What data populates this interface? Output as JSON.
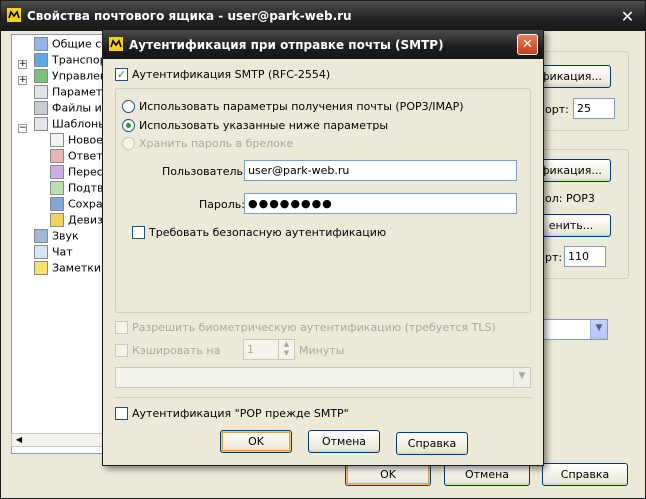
{
  "outer": {
    "title": "Свойства почтового ящика - user@park-web.ru",
    "tree": [
      {
        "label": "Общие сведения",
        "icon": "mailbox-icon",
        "expander": false
      },
      {
        "label": "Транспорт",
        "icon": "transport-icon",
        "expander": true
      },
      {
        "label": "Управление",
        "icon": "management-icon",
        "expander": true
      },
      {
        "label": "Параметры",
        "icon": "parameters-icon",
        "expander": false
      },
      {
        "label": "Файлы и каталоги",
        "icon": "files-icon",
        "expander": false
      },
      {
        "label": "Шаблоны",
        "icon": "templates-icon",
        "expander": true
      },
      {
        "label": "Новое",
        "icon": "new-template-icon",
        "expander": false
      },
      {
        "label": "Ответ",
        "icon": "reply-template-icon",
        "expander": false
      },
      {
        "label": "Пересылка",
        "icon": "forward-template-icon",
        "expander": false
      },
      {
        "label": "Подтверждение",
        "icon": "confirm-template-icon",
        "expander": false
      },
      {
        "label": "Сохранение",
        "icon": "save-template-icon",
        "expander": false
      },
      {
        "label": "Девиз",
        "icon": "motto-template-icon",
        "expander": false
      },
      {
        "label": "Звук",
        "icon": "sound-icon",
        "expander": false
      },
      {
        "label": "Чат",
        "icon": "chat-icon",
        "expander": false
      },
      {
        "label": "Заметки",
        "icon": "notes-icon",
        "expander": false
      }
    ],
    "right": {
      "auth_btn_1": "фикация...",
      "port_label_1": "орт:",
      "port_value_1": "25",
      "auth_btn_2": "фикация...",
      "proto_label": "ол:",
      "proto_value": "POP3",
      "change_btn": "енить...",
      "port_label_2": "рт:",
      "port_value_2": "110"
    },
    "buttons": {
      "ok": "OK",
      "cancel": "Отмена",
      "help": "Справка"
    }
  },
  "dialog": {
    "title": "Аутентификация при отправке почты (SMTP)",
    "smtp_auth": {
      "label": "Аутентификация SMTP (RFC-2554)",
      "checked": true
    },
    "radio_use_receive": "Использовать параметры получения почты (POP3/IMAP)",
    "radio_use_below": "Использовать указанные ниже параметры",
    "keychain": "Хранить пароль в брелоке",
    "user_label": "Пользователь:",
    "user_value": "user@park-web.ru",
    "password_label": "Пароль:",
    "password_value": "●●●●●●●●",
    "secure_auth": "Требовать безопасную аутентификацию",
    "biometric": "Разрешить биометрическую аутентификацию (требуется TLS)",
    "cache_label": "Кэшировать на",
    "cache_value": "1",
    "cache_unit": "Минуты",
    "pop_before_smtp": "Аутентификация \"POP прежде SMTP\"",
    "buttons": {
      "ok": "OK",
      "cancel": "Отмена",
      "help": "Справка"
    }
  },
  "colors": {
    "title_bar": "#1e1e1e",
    "dialog_bg": "#ece9d8",
    "close_red": "#c3401b",
    "check_green": "#21a121"
  }
}
